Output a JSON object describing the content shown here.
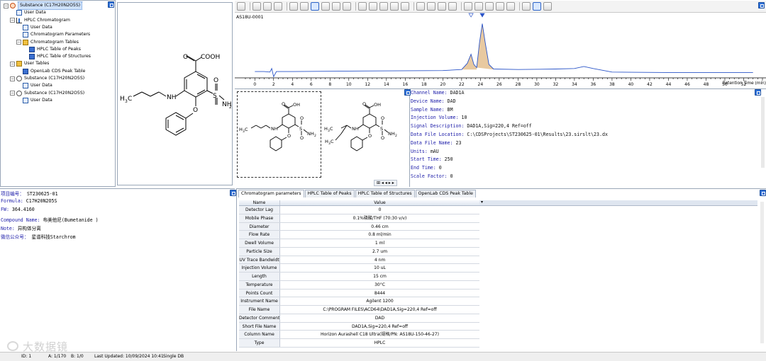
{
  "tree": {
    "items": [
      {
        "label": "Substance (C17H20N2O5S)",
        "level": 0,
        "icon": "substance-icon",
        "expander": "−"
      },
      {
        "label": "User Data",
        "level": 1,
        "icon": "document-icon",
        "expander": ""
      },
      {
        "label": "HPLC Chromatogram",
        "level": 1,
        "icon": "chart-icon",
        "expander": "−"
      },
      {
        "label": "User Data",
        "level": 2,
        "icon": "document-icon",
        "expander": ""
      },
      {
        "label": "Chromatogram Parameters",
        "level": 2,
        "icon": "document-icon",
        "expander": ""
      },
      {
        "label": "Chromatogram Tables",
        "level": 2,
        "icon": "table-folder-icon",
        "expander": "−"
      },
      {
        "label": "HPLC Table of Peaks",
        "level": 3,
        "icon": "table-icon",
        "expander": ""
      },
      {
        "label": "HPLC Table of Structures",
        "level": 3,
        "icon": "table-icon",
        "expander": ""
      },
      {
        "label": "User Tables",
        "level": 1,
        "icon": "table-folder-icon",
        "expander": "−"
      },
      {
        "label": "OpenLab CDS Peak Table",
        "level": 2,
        "icon": "table-icon",
        "expander": ""
      },
      {
        "label": "Substance (C17H20N2O5S)",
        "level": 1,
        "icon": "substance-outline-icon",
        "expander": "−"
      },
      {
        "label": "User Data",
        "level": 2,
        "icon": "document-icon",
        "expander": ""
      },
      {
        "label": "Substance (C17H20N2O5S)",
        "level": 1,
        "icon": "substance-outline-icon",
        "expander": "−"
      },
      {
        "label": "User Data",
        "level": 2,
        "icon": "document-icon",
        "expander": ""
      }
    ]
  },
  "structure": {
    "atoms": {
      "cooh": "COOH",
      "nh": "NH",
      "s": "S",
      "o1": "O",
      "o2": "O",
      "nh2": "NH",
      "nh2_sub": "2",
      "ring_o": "O",
      "ch3": "H",
      "ch3_sub": "3",
      "ch3_c": "C"
    }
  },
  "chromatogram": {
    "sample_label": "AS18U-0001",
    "axis_label": "Retention Time (min)",
    "x_ticks": [
      "0",
      "2",
      "4",
      "6",
      "8",
      "10",
      "12",
      "14",
      "16",
      "18",
      "20",
      "22",
      "24",
      "26",
      "28",
      "30",
      "32",
      "34",
      "36",
      "38",
      "40",
      "42",
      "44",
      "46",
      "48",
      "50",
      "52"
    ]
  },
  "chart_data": {
    "type": "line",
    "xlabel": "Retention Time (min)",
    "ylabel": "",
    "xlim": [
      -1,
      54
    ],
    "series": [
      {
        "values_x": [
          0,
          1,
          1.6,
          1.8,
          2.0,
          2.3,
          4,
          10,
          20,
          22,
          22.6,
          23,
          23.3,
          23.6,
          23.9,
          24.2,
          24.5,
          24.9,
          25.4,
          28,
          32,
          34,
          35,
          36,
          38,
          45,
          53
        ],
        "values_y": [
          4,
          4,
          3,
          10,
          -6,
          4,
          4,
          5,
          6,
          8,
          20,
          38,
          18,
          12,
          60,
          98,
          62,
          18,
          9,
          8,
          9,
          10,
          14,
          10,
          3,
          2,
          2
        ]
      }
    ],
    "peak_markers": [
      23.0,
      24.2
    ]
  },
  "structures_pair": {
    "left": {
      "cooh": "OH",
      "o": "O",
      "nh": "NH",
      "s": "S",
      "so": "O",
      "so2": "O",
      "nh2": "NH",
      "nh2_sub": "2",
      "ch3": "H",
      "ch3_sub": "3",
      "ch3_c": "C"
    },
    "right": {
      "cooh": "OH",
      "o": "O",
      "nh": "NH",
      "s": "S",
      "so": "O",
      "so2": "O",
      "nh2": "NH",
      "nh2_sub": "2",
      "ch3a": "H",
      "ch3a_sub": "3",
      "ch3a_c": "C",
      "ch3b": "H",
      "ch3b_sub": "3",
      "ch3b_c": "C"
    },
    "pager": "⊞  ◂ ◂  ▸ ▸"
  },
  "info": {
    "lines": [
      {
        "k": "Channel Name:",
        "v": "DAD1A"
      },
      {
        "k": "Device Name:",
        "v": "DAD"
      },
      {
        "k": "Sample Name:",
        "v": "BM"
      },
      {
        "k": "Injection Volume:",
        "v": "10"
      },
      {
        "k": "Signal Description:",
        "v": "DAD1A,Sig=220,4  Ref=off"
      },
      {
        "k": "Data File Location:",
        "v": "C:\\CDSProjects\\ST230625-01\\Results\\23.sirslt\\23.dx"
      },
      {
        "k": "Data File Name:",
        "v": "23"
      },
      {
        "k": "Units:",
        "v": "mAU"
      },
      {
        "k": "Start Time:",
        "v": "250"
      },
      {
        "k": "End Time:",
        "v": "0"
      },
      {
        "k": "Scale Factor:",
        "v": "0"
      }
    ]
  },
  "properties": {
    "lines": [
      {
        "k": "项目编号：",
        "v": "ST230625-01"
      },
      {
        "k": "Formula:",
        "v": "C17H20N2O5S"
      },
      {
        "k": "FW:",
        "v": "364.4160"
      },
      {
        "k": "Compound Name:",
        "v": "布美他尼(Bumetanide )"
      },
      {
        "k": "Note:",
        "v": "异构体分离"
      },
      {
        "k": "微信公众号：",
        "v": "星谱科技Starchrom"
      }
    ]
  },
  "tabs": [
    "Chromatogram parameters",
    "HPLC Table of Peaks",
    "HPLC Table of Structures",
    "OpenLab CDS Peak Table"
  ],
  "grid": {
    "header": {
      "name": "Name",
      "value": "Value"
    },
    "rows": [
      {
        "name": "Detector Lag",
        "value": "0"
      },
      {
        "name": "Mobile Phase",
        "value": "0.1%磷酸/THF (70:30 v/v)"
      },
      {
        "name": "Diameter",
        "value": "0.46 cm"
      },
      {
        "name": "Flow Rate",
        "value": "0.8 ml/min"
      },
      {
        "name": "Dwell Volume",
        "value": "1 ml"
      },
      {
        "name": "Particle Size",
        "value": "2.7 um"
      },
      {
        "name": "UV Trace Bandwidt",
        "value": "4 nm"
      },
      {
        "name": "Injection Volume",
        "value": "10 uL"
      },
      {
        "name": "Length",
        "value": "15 cm"
      },
      {
        "name": "Temperature",
        "value": "30°C"
      },
      {
        "name": "Points Count",
        "value": "8444"
      },
      {
        "name": "Instrument Name",
        "value": "Agilent 1200"
      },
      {
        "name": "File Name",
        "value": "C:\\PROGRAM FILES\\ACD64\\DAD1A,Sig=220,4  Ref=off"
      },
      {
        "name": "Detector Comment",
        "value": "DAD"
      },
      {
        "name": "Short File Name",
        "value": "DAD1A,Sig=220,4  Ref=off"
      },
      {
        "name": "Column Name",
        "value": "Horizon Aurashell C18 Ultra(规格/PN: AS18U-150-46-27)"
      },
      {
        "name": "Type",
        "value": "HPLC"
      }
    ]
  },
  "status": {
    "id": "ID: 1",
    "a": "A: 1/170",
    "b": "B: 1/0",
    "updated": "Last Updated: 10/09/2024 10:41",
    "db": "Single DB",
    "watermark": "大数据镜"
  }
}
